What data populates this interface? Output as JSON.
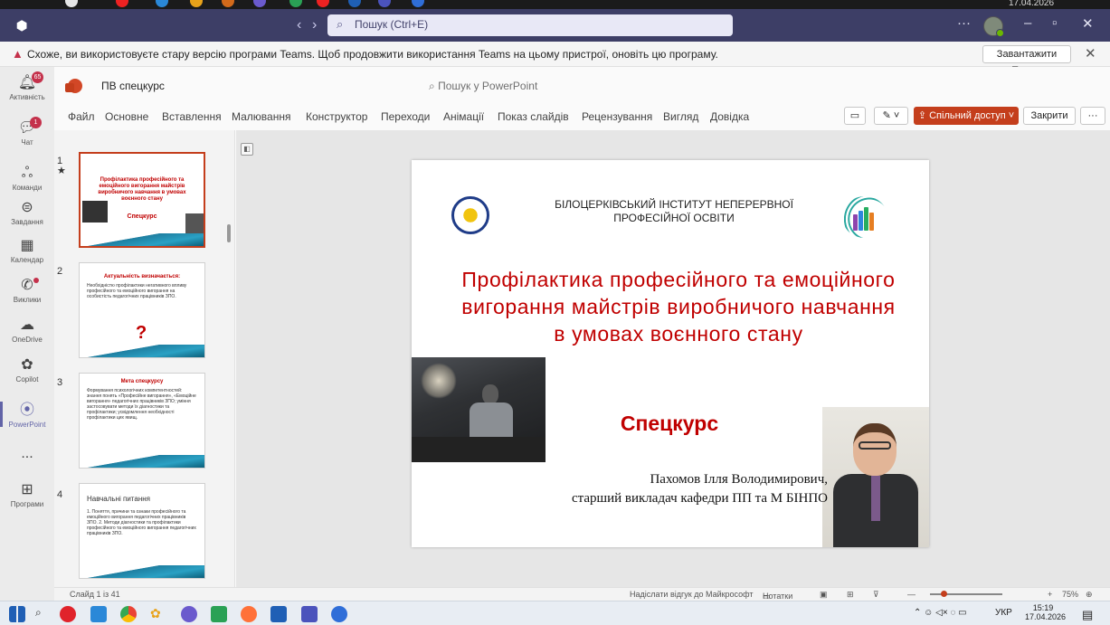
{
  "titlebar": {
    "search_placeholder": "Пошук (Ctrl+E)",
    "top_date": "17.04.2026"
  },
  "warning": {
    "text": "Схоже, ви використовуєте стару версію програми Teams. Щоб продовжити використання Teams на цьому пристрої, оновіть цю програму.",
    "button": "Завантажити Teams"
  },
  "rail": [
    {
      "label": "Активність",
      "icon": "bell-icon",
      "badge": "65"
    },
    {
      "label": "Чат",
      "icon": "chat-icon",
      "badge": "1"
    },
    {
      "label": "Команди",
      "icon": "teams-icon"
    },
    {
      "label": "Завдання",
      "icon": "tasks-icon"
    },
    {
      "label": "Календар",
      "icon": "calendar-icon"
    },
    {
      "label": "Виклики",
      "icon": "phone-icon"
    },
    {
      "label": "OneDrive",
      "icon": "onedrive-icon"
    },
    {
      "label": "Copilot",
      "icon": "copilot-icon"
    },
    {
      "label": "PowerPoint",
      "icon": "powerpoint-icon"
    },
    {
      "label": "...",
      "icon": "more-icon"
    },
    {
      "label": "Програми",
      "icon": "apps-icon"
    }
  ],
  "ppt": {
    "doc_name": "ПВ спецкурс",
    "search": "Пошук у PowerPoint",
    "tabs": [
      "Файл",
      "Основне",
      "Вставлення",
      "Малювання",
      "Конструктор",
      "Переходи",
      "Анімації",
      "Показ слайдів",
      "Рецензування",
      "Вигляд",
      "Довідка"
    ],
    "share_label": "Спільний доступ",
    "close_label": "Закрити",
    "more_label": "···"
  },
  "thumbnails": [
    {
      "number": "1",
      "title": "Профілактика професійного та емоційного вигорання майстрів виробничого навчання в умовах воєнного стану",
      "sub": "Спецкурс"
    },
    {
      "number": "2",
      "title": "Актуальність визначається:",
      "body": "Необхідністю профілактики негативного впливу професійного та емоційного вигорання на особистість педагогічних працівників ЗПО."
    },
    {
      "number": "3",
      "title": "Мета спецкурсу",
      "body": "Формування психологічних компетентностей: знання понять «Професійне вигорання», «Емоційне вигорання» педагогічних працівників ЗПО; уміння застосовувати методи їх діагностики та профілактики; усвідомлення необхідності профілактики цих явищ."
    },
    {
      "number": "4",
      "title": "Навчальні питання",
      "body": "1. Поняття, причини та ознаки професійного та емоційного вигорання педагогічних працівників ЗПО. 2. Методи діагностики та профілактики професійного та емоційного вигорання педагогічних працівників ЗПО."
    }
  ],
  "slide": {
    "institute": "БІЛОЦЕРКІВСЬКИЙ ІНСТИТУТ НЕПЕРЕРВНОЇ ПРОФЕСІЙНОЇ ОСВІТИ",
    "title": "Профілактика професійного та емоційного вигорання майстрів виробничого навчання в умовах воєнного стану",
    "subtitle": "Спецкурс",
    "author_line1": "Пахомов Ілля Володимирович,",
    "author_line2": "старший викладач кафедри ПП та М БІНПО"
  },
  "status": {
    "slide_counter": "Слайд 1 із 41",
    "feedback": "Надіслати відгук до Майкрософт",
    "notes": "Нотатки",
    "zoom": "75%"
  },
  "taskbar": {
    "lang": "УКР",
    "time": "15:19",
    "date": "17.04.2026"
  }
}
